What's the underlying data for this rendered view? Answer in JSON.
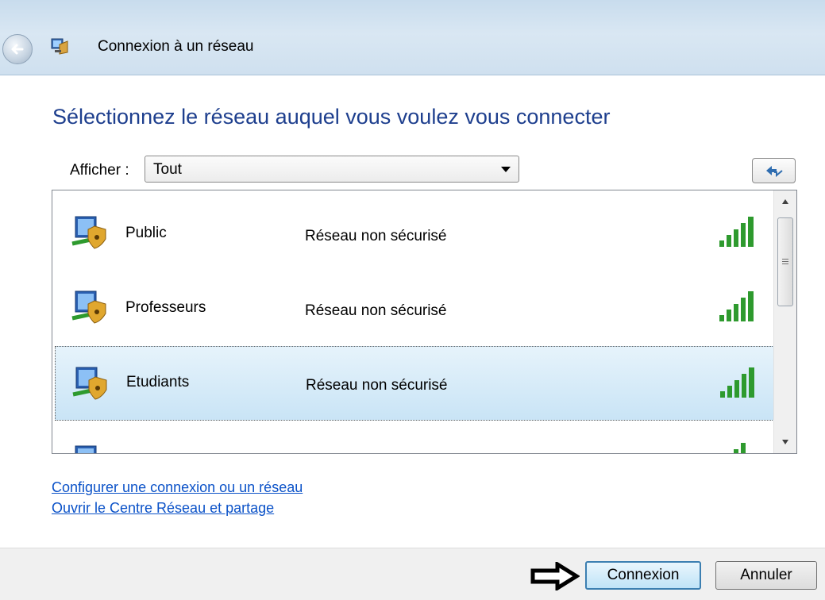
{
  "window": {
    "title": "Connexion à un réseau"
  },
  "heading": "Sélectionnez le réseau auquel vous voulez vous connecter",
  "filter": {
    "label": "Afficher :",
    "selected": "Tout"
  },
  "networks": [
    {
      "name": "Public",
      "security": "Réseau non sécurisé",
      "signal_bars": 5,
      "selected": false
    },
    {
      "name": "Professeurs",
      "security": "Réseau non sécurisé",
      "signal_bars": 5,
      "selected": false
    },
    {
      "name": "Etudiants",
      "security": "Réseau non sécurisé",
      "signal_bars": 5,
      "selected": true
    }
  ],
  "links": {
    "setup": "Configurer une connexion ou un réseau",
    "center": "Ouvrir le Centre Réseau et partage"
  },
  "buttons": {
    "connect": "Connexion",
    "cancel": "Annuler"
  },
  "colors": {
    "heading": "#1e3f8e",
    "link": "#0b52c8",
    "signal": "#2e9a2e",
    "selection": "#c9e4f6"
  },
  "icons": [
    "back-arrow-icon",
    "network-setup-icon",
    "dropdown-arrow-icon",
    "refresh-icon",
    "network-shield-icon",
    "signal-strength-icon",
    "scroll-up-icon",
    "scroll-down-icon",
    "black-arrow-icon"
  ]
}
